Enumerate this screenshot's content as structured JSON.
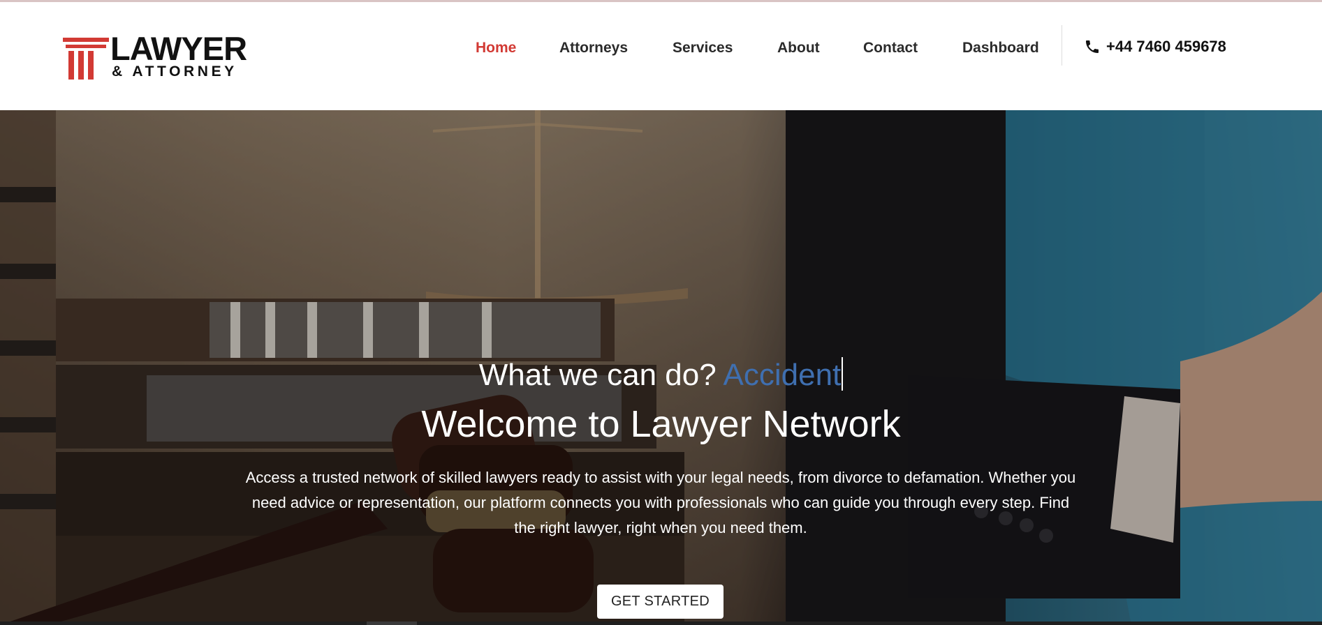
{
  "brand": {
    "name": "LAWYER",
    "tagline": "& ATTORNEY",
    "accent_color": "#d23a34"
  },
  "nav": {
    "items": [
      {
        "label": "Home",
        "active": true
      },
      {
        "label": "Attorneys",
        "active": false
      },
      {
        "label": "Services",
        "active": false
      },
      {
        "label": "About",
        "active": false
      },
      {
        "label": "Contact",
        "active": false
      },
      {
        "label": "Dashboard",
        "active": false
      }
    ],
    "phone": {
      "icon": "phone-icon",
      "number": "+44 7460 459678"
    }
  },
  "hero": {
    "kicker": "What we can do?",
    "typed_word": "Accident",
    "typed_word_color": "#3f6fb0",
    "title": "Welcome to Lawyer Network",
    "description": "Access a trusted network of skilled lawyers ready to assist with your legal needs, from divorce to defamation. Whether you need advice or representation, our platform connects you with professionals who can guide you through every step. Find the right lawyer, right when you need them.",
    "cta_label": "GET STARTED"
  }
}
